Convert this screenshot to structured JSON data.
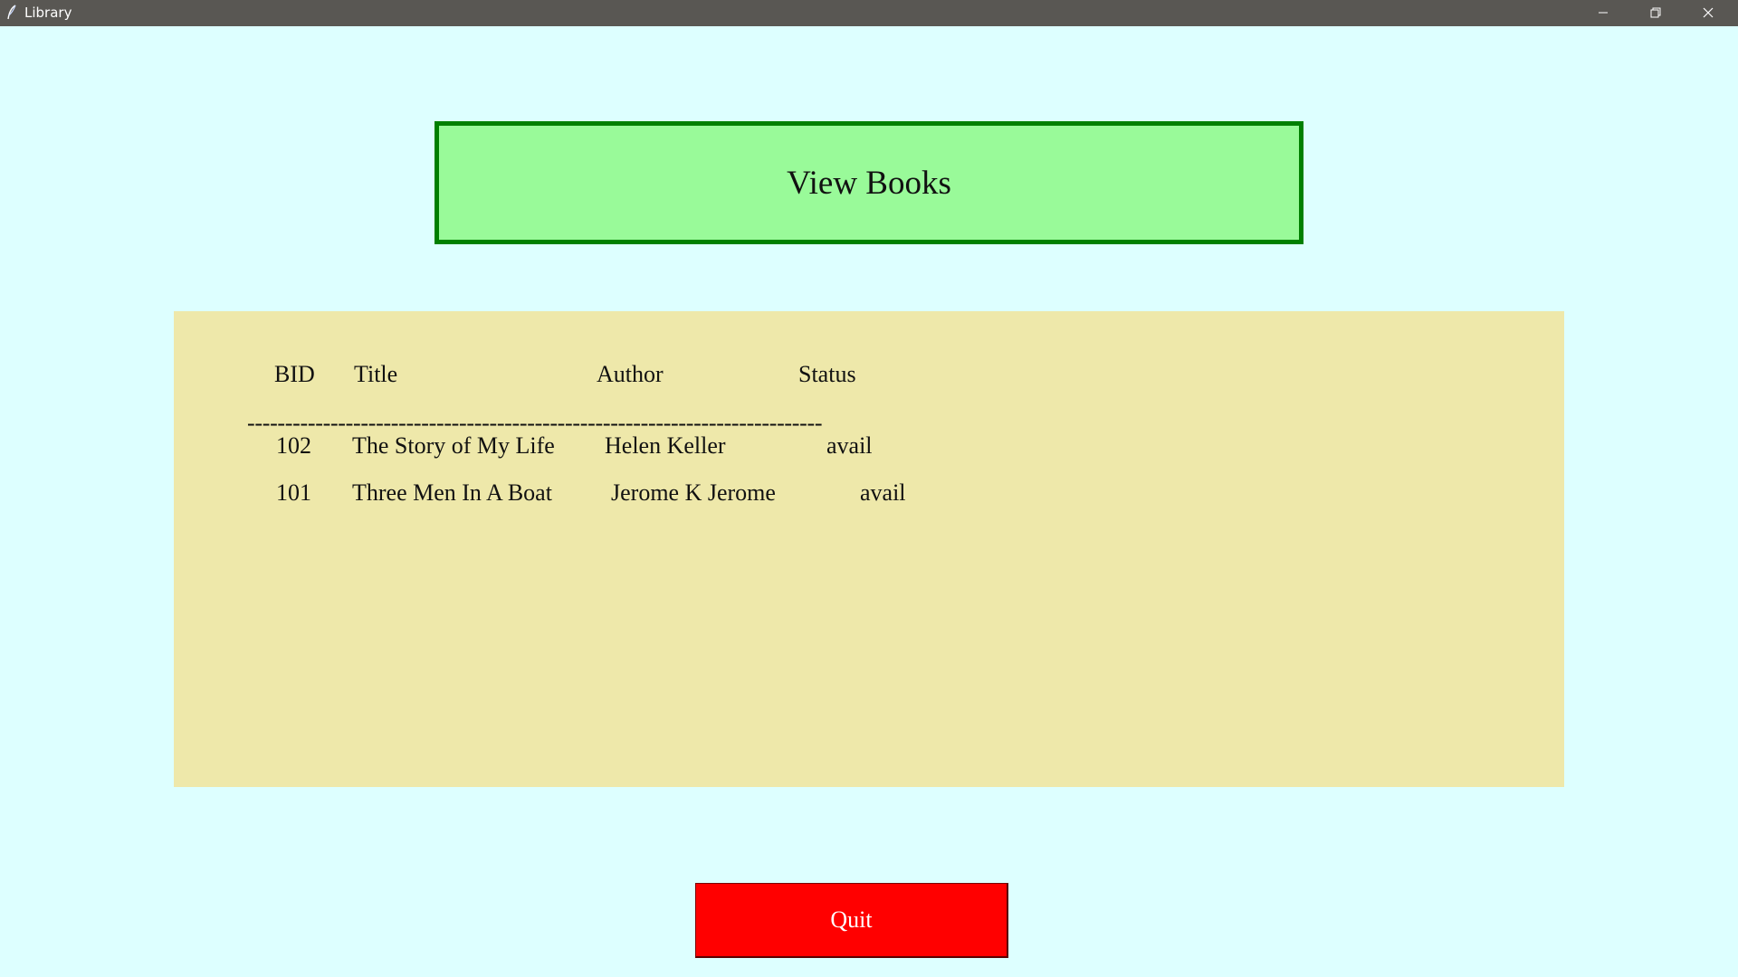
{
  "window": {
    "title": "Library",
    "icons": {
      "app": "feather-icon",
      "minimize": "minimize-icon",
      "maximize": "restore-icon",
      "close": "close-icon"
    }
  },
  "heading": {
    "text": "View Books"
  },
  "books": {
    "headers": {
      "bid": "BID",
      "title": "Title",
      "author": "Author",
      "status": "Status"
    },
    "divider": "----------------------------------------------------------------------------",
    "rows": [
      {
        "bid": "102",
        "title": "The Story of My Life",
        "author": "Helen Keller",
        "status": "avail"
      },
      {
        "bid": "101",
        "title": "Three Men In A Boat",
        "author": "Jerome K Jerome",
        "status": "avail"
      }
    ]
  },
  "quit_button": {
    "label": "Quit"
  },
  "colors": {
    "window_background": "#ddffff",
    "heading_background": "#99fa99",
    "heading_border": "#008000",
    "list_background": "#eee8aa",
    "quit_background": "#ff0000",
    "titlebar": "#595753"
  }
}
